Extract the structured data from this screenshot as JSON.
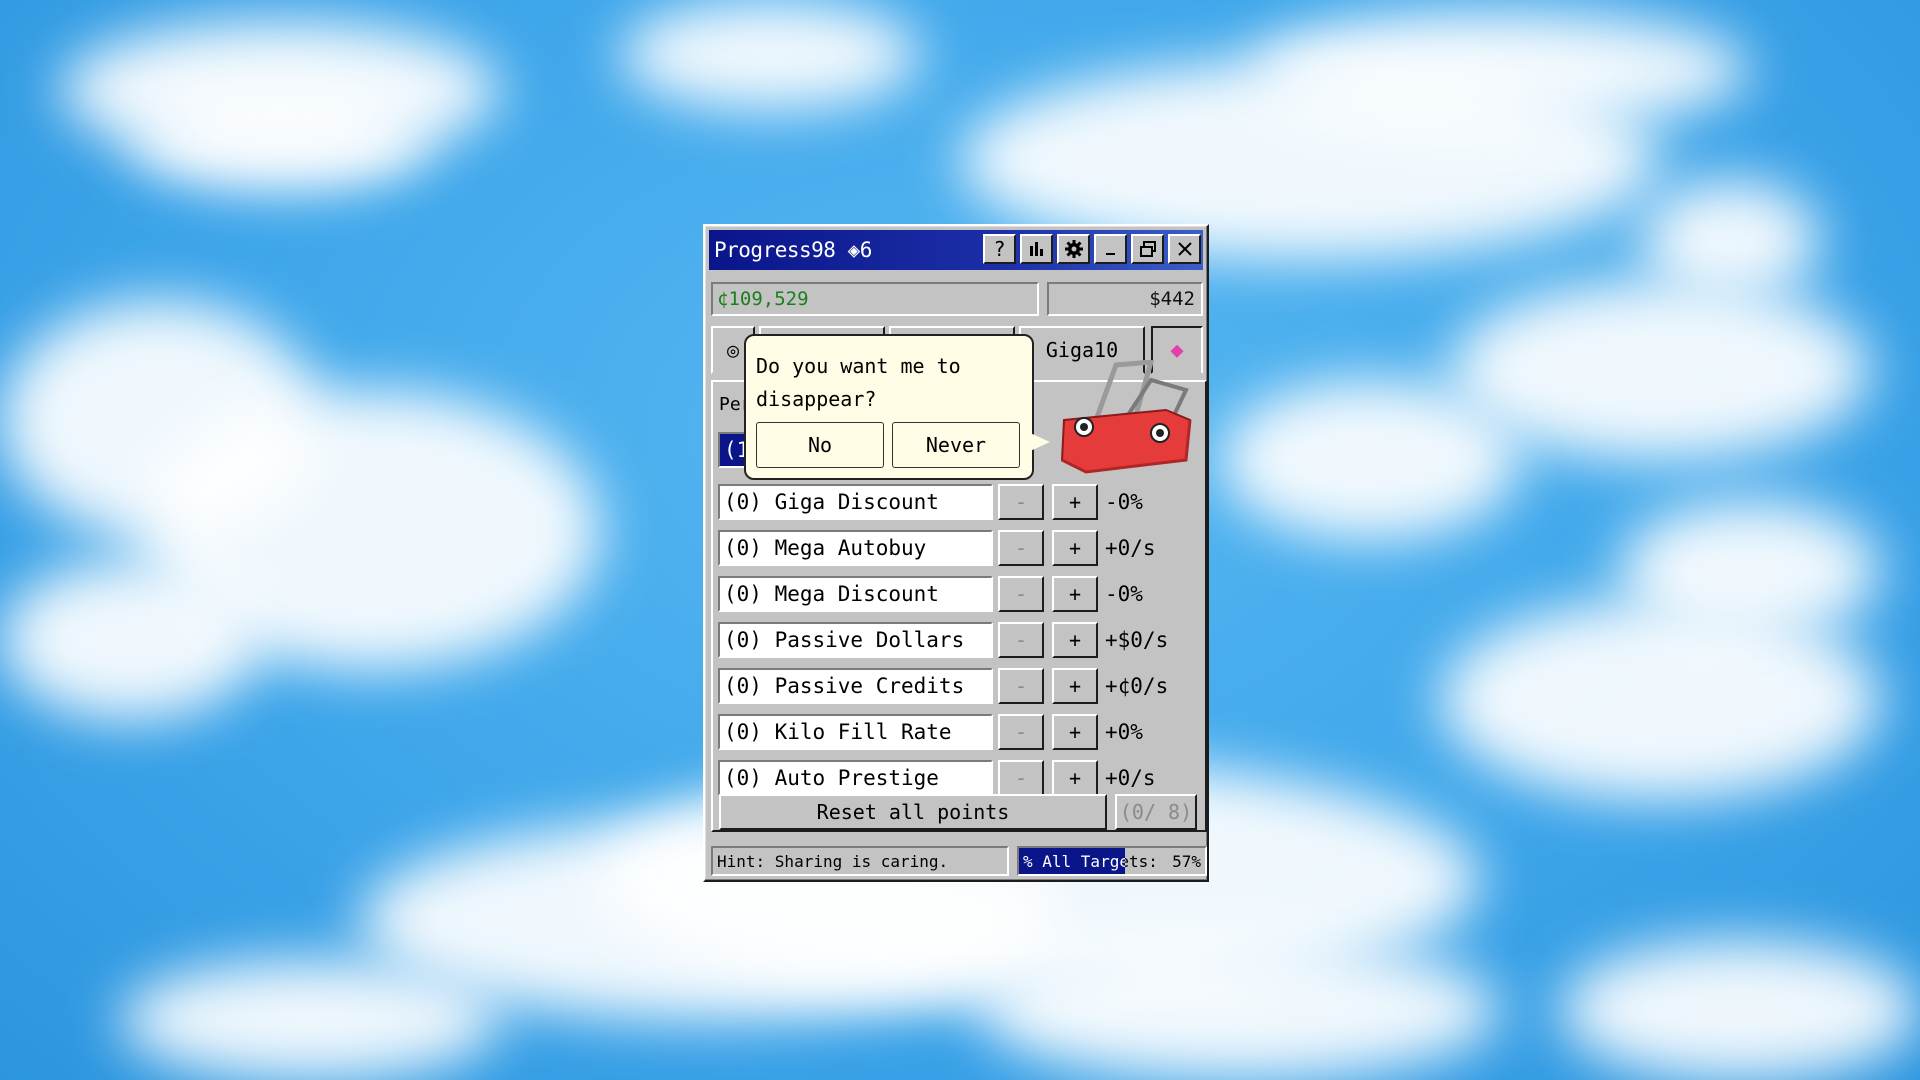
{
  "window": {
    "title": "Progress98 ◈6",
    "title_buttons": [
      "?",
      "",
      "",
      "",
      "",
      ""
    ],
    "credits": "¢109,529",
    "dollars": "$442",
    "tabs": [
      "◎",
      "",
      "",
      "Giga10",
      "◆"
    ],
    "panel_label": "Per",
    "highlighted_row_prefix": "(1",
    "rows": [
      {
        "name": "(0) Giga Discount",
        "effect": "-0%"
      },
      {
        "name": "(0) Mega Autobuy",
        "effect": "+0/s"
      },
      {
        "name": "(0) Mega Discount",
        "effect": "-0%"
      },
      {
        "name": "(0) Passive Dollars",
        "effect": "+$0/s"
      },
      {
        "name": "(0) Passive Credits",
        "effect": "+¢0/s"
      },
      {
        "name": "(0) Kilo Fill Rate",
        "effect": "+0%"
      },
      {
        "name": "(0) Auto Prestige",
        "effect": "+0/s"
      }
    ],
    "minus_label": "-",
    "plus_label": "+",
    "reset_label": "Reset all points",
    "points_label": "(0/ 8)",
    "hint": "Hint: Sharing is caring.",
    "progress_label": "% All Targets:",
    "progress_percent": "57%",
    "progress_value": 0.57
  },
  "assistant": {
    "question": "Do you want me to disappear?",
    "no_label": "No",
    "never_label": "Never"
  },
  "colors": {
    "titlebar": "#0a158a",
    "credits_text": "#1b7f1b",
    "diamond": "#e23fa8",
    "clip_red": "#e53b3b"
  }
}
